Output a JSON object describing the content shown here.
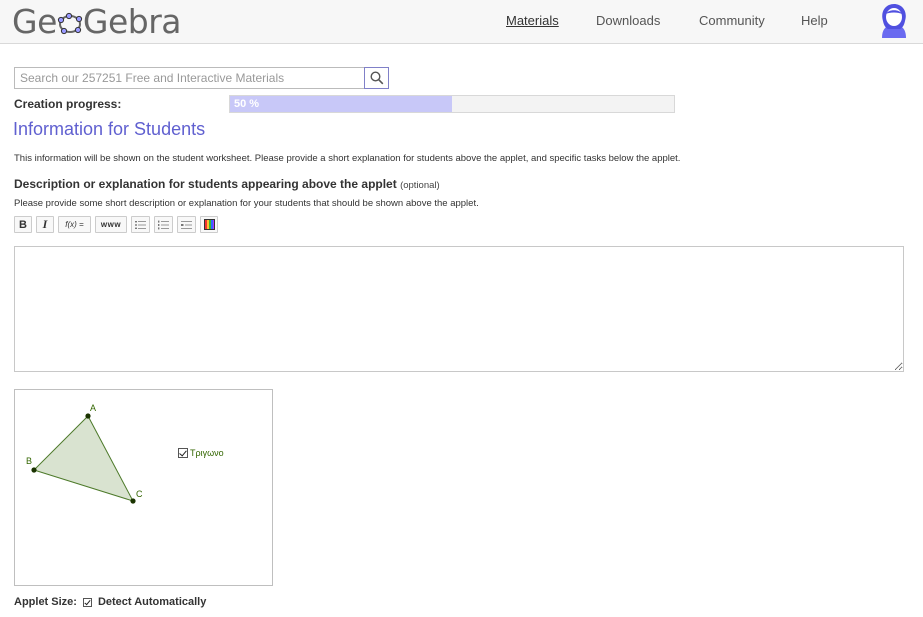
{
  "header": {
    "logo_text_1": "Ge",
    "logo_text_2": "Gebra",
    "nav": {
      "materials": "Materials",
      "downloads": "Downloads",
      "community": "Community",
      "help": "Help"
    },
    "avatar_icon": "user-avatar-icon"
  },
  "search": {
    "placeholder": "Search our 257251 Free and Interactive Materials",
    "value": "",
    "icon": "search-icon"
  },
  "progress": {
    "label": "Creation progress:",
    "percent_text": "50 %",
    "value": 0.5
  },
  "main": {
    "title": "Information for Students",
    "info_text": "This information will be shown on the student worksheet. Please provide a short explanation for students above the applet, and specific tasks below the applet.",
    "desc_title": "Description or explanation for students appearing above the applet",
    "desc_optional": "(optional)",
    "desc_help": "Please provide some short description or explanation for your students that should be shown above the applet.",
    "toolbar": {
      "bold": "B",
      "italic": "I",
      "formula": "f(x) =",
      "link": "www"
    },
    "textarea_value": ""
  },
  "applet": {
    "points": {
      "a": "A",
      "b": "B",
      "c": "C"
    },
    "checkbox_label": "Τριγωνο",
    "checkbox_checked": true
  },
  "applet_size": {
    "label": "Applet Size:",
    "option": "Detect Automatically",
    "checked": true
  },
  "colors": {
    "accent": "#6060d0",
    "progress_fill": "#c8c8f8",
    "triangle_fill": "#d9e3d0",
    "triangle_stroke": "#4d7a2a"
  }
}
